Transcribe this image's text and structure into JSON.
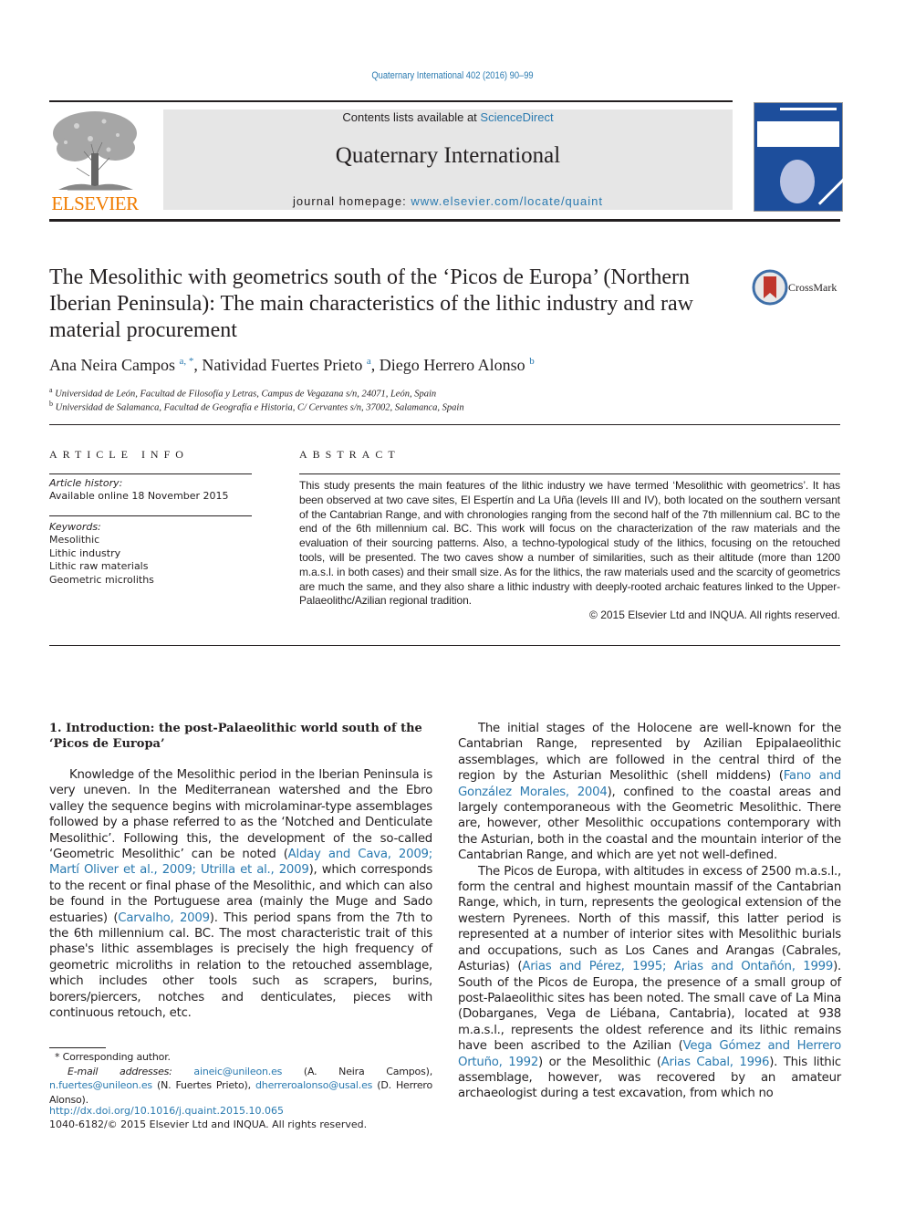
{
  "header": {
    "citation": "Quaternary International 402 (2016) 90–99",
    "contents_prefix": "Contents lists available at ",
    "contents_link": "ScienceDirect",
    "journal_name": "Quaternary International",
    "homepage_prefix": "journal homepage: ",
    "homepage_link": "www.elsevier.com/locate/quaint",
    "publisher_logo": "ELSEVIER",
    "crossmark_label": "CrossMark",
    "colors": {
      "link": "#2a7ab0",
      "elsevier_orange": "#f07c00",
      "masthead_bg": "#e6e6e6",
      "cover_blue": "#1d4e9c"
    }
  },
  "article": {
    "title": "The Mesolithic with geometrics south of the ‘Picos de Europa’ (Northern Iberian Peninsula): The main characteristics of the lithic industry and raw material procurement",
    "authors": [
      {
        "name": "Ana Neira Campos",
        "sup": "a, *"
      },
      {
        "name": "Natividad Fuertes Prieto",
        "sup": "a"
      },
      {
        "name": "Diego Herrero Alonso",
        "sup": "b"
      }
    ],
    "affiliations": [
      {
        "key": "a",
        "text": "Universidad de León, Facultad de Filosofía y Letras, Campus de Vegazana s/n, 24071, León, Spain"
      },
      {
        "key": "b",
        "text": "Universidad de Salamanca, Facultad de Geografía e Historia, C/ Cervantes s/n, 37002, Salamanca, Spain"
      }
    ]
  },
  "article_info": {
    "heading": "ARTICLE INFO",
    "history_label": "Article history:",
    "history_value": "Available online 18 November 2015",
    "keywords_label": "Keywords:",
    "keywords": [
      "Mesolithic",
      "Lithic industry",
      "Lithic raw materials",
      "Geometric microliths"
    ]
  },
  "abstract": {
    "heading": "ABSTRACT",
    "text": "This study presents the main features of the lithic industry we have termed ‘Mesolithic with geometrics’. It has been observed at two cave sites, El Espertín and La Uña (levels III and IV), both located on the southern versant of the Cantabrian Range, and with chronologies ranging from the second half of the 7th millennium cal. BC to the end of the 6th millennium cal. BC. This work will focus on the characterization of the raw materials and the evaluation of their sourcing patterns. Also, a techno-typological study of the lithics, focusing on the retouched tools, will be presented. The two caves show a number of similarities, such as their altitude (more than 1200 m.a.s.l. in both cases) and their small size. As for the lithics, the raw materials used and the scarcity of geometrics are much the same, and they also share a lithic industry with deeply-rooted archaic features linked to the Upper-Palaeolithc/Azilian regional tradition.",
    "copyright": "© 2015 Elsevier Ltd and INQUA. All rights reserved."
  },
  "section1": {
    "heading": "1.  Introduction: the post-Palaeolithic world south of the ‘Picos de Europa’",
    "p1": [
      {
        "t": "Knowledge of the Mesolithic period in the Iberian Peninsula is very uneven. In the Mediterranean watershed and the Ebro valley the sequence begins with microlaminar-type assemblages followed by a phase referred to as the ‘Notched and Denticulate Mesolithic’. Following this, the development of the so-called ‘Geometric Mesolithic’ can be noted ("
      },
      {
        "link": "Alday and Cava, 2009; Martí Oliver et al., 2009; Utrilla et al., 2009"
      },
      {
        "t": "), which corresponds to the recent or final phase of the Mesolithic, and which can also be found in the Portuguese area (mainly the Muge and Sado estuaries) ("
      },
      {
        "link": "Carvalho, 2009"
      },
      {
        "t": "). This period spans from the 7th to the 6th millennium cal. BC. The most characteristic trait of this phase's lithic assemblages is precisely the high frequency of geometric microliths in relation to the retouched assemblage, which includes other tools such as scrapers, burins, borers/piercers, notches and denticulates, pieces with continuous retouch, etc."
      }
    ],
    "p2": [
      {
        "t": "The initial stages of the Holocene are well-known for the Cantabrian Range, represented by Azilian Epipalaeolithic assemblages, which are followed in the central third of the region by the Asturian Mesolithic (shell middens) ("
      },
      {
        "link": "Fano and González Morales, 2004"
      },
      {
        "t": "), confined to the coastal areas and largely contemporaneous with the Geometric Mesolithic. There are, however, other Mesolithic occupations contemporary with the Asturian, both in the coastal and the mountain interior of the Cantabrian Range, and which are yet not well-defined."
      }
    ],
    "p3": [
      {
        "t": "The Picos de Europa, with altitudes in excess of 2500 m.a.s.l., form the central and highest mountain massif of the Cantabrian Range, which, in turn, represents the geological extension of the western Pyrenees. North of this massif, this latter period is represented at a number of interior sites with Mesolithic burials and occupations, such as Los Canes and Arangas (Cabrales, Asturias) ("
      },
      {
        "link": "Arias and Pérez, 1995; Arias and Ontañón, 1999"
      },
      {
        "t": "). South of the Picos de Europa, the presence of a small group of post-Palaeolithic sites has been noted. The small cave of La Mina (Dobarganes, Vega de Liébana, Cantabria), located at 938 m.a.s.l., represents the oldest reference and its lithic remains have been ascribed to the Azilian ("
      },
      {
        "link": "Vega Gómez and Herrero Ortuño, 1992"
      },
      {
        "t": ") or the Mesolithic ("
      },
      {
        "link": "Arias Cabal, 1996"
      },
      {
        "t": "). This lithic assemblage, however, was recovered by an amateur archaeologist during a test excavation, from which no"
      }
    ]
  },
  "footnotes": {
    "corresponding": "* Corresponding author.",
    "email_label": "E-mail addresses:",
    "emails": [
      {
        "email": "aineic@unileon.es",
        "who": " (A. Neira Campos), "
      },
      {
        "email": "n.fuertes@unileon.es",
        "who": " (N. Fuertes Prieto), "
      },
      {
        "email": "dherreroalonso@usal.es",
        "who": " (D. Herrero Alonso)."
      }
    ],
    "doi": "http://dx.doi.org/10.1016/j.quaint.2015.10.065",
    "issn": "1040-6182/© 2015 Elsevier Ltd and INQUA. All rights reserved."
  }
}
